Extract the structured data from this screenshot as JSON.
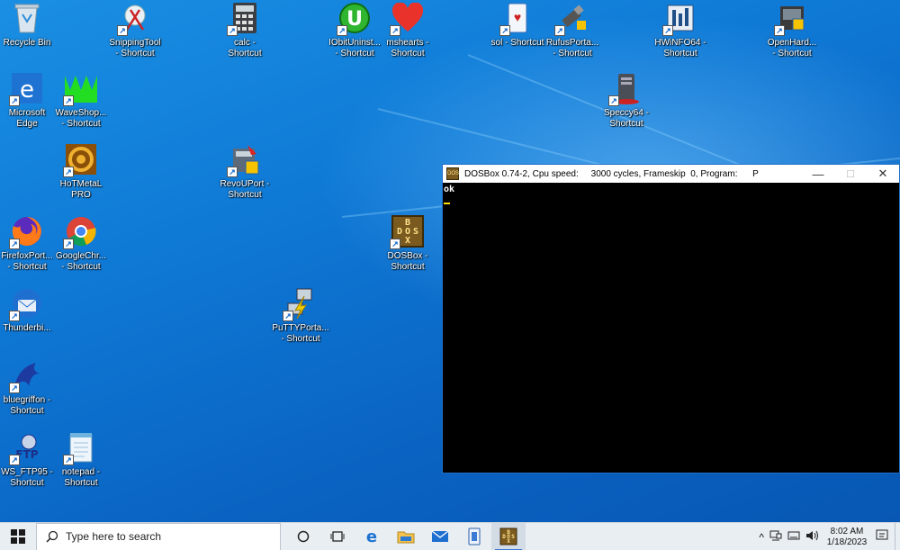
{
  "desktop": {
    "icons": [
      {
        "label": "Recycle Bin"
      },
      {
        "label": "SnippingTool\n- Shortcut"
      },
      {
        "label": "calc -\nShortcut"
      },
      {
        "label": "IObitUninst...\n- Shortcut"
      },
      {
        "label": "mshearts -\nShortcut"
      },
      {
        "label": "sol - Shortcut"
      },
      {
        "label": "RufusPorta...\n- Shortcut"
      },
      {
        "label": "HWiNFO64 -\nShortcut"
      },
      {
        "label": "OpenHard...\n- Shortcut"
      },
      {
        "label": "Microsoft\nEdge"
      },
      {
        "label": "WaveShop...\n- Shortcut"
      },
      {
        "label": "Speccy64 -\nShortcut"
      },
      {
        "label": "HoTMetaL\nPRO"
      },
      {
        "label": "RevoUPort -\nShortcut"
      },
      {
        "label": "FirefoxPort...\n- Shortcut"
      },
      {
        "label": "GoogleChr...\n- Shortcut"
      },
      {
        "label": "DOSBox -\nShortcut"
      },
      {
        "label": "Thunderbi..."
      },
      {
        "label": "PuTTYPorta...\n- Shortcut"
      },
      {
        "label": "bluegriffon -\nShortcut"
      },
      {
        "label": "WS_FTP95 -\nShortcut"
      },
      {
        "label": "notepad -\nShortcut"
      }
    ]
  },
  "dosbox": {
    "title": "DOSBox 0.74-2, Cpu speed:     3000 cycles, Frameskip  0, Program:      P",
    "screen_line": "ok",
    "minimize": "—",
    "maximize": "☐",
    "close": "✕"
  },
  "taskbar": {
    "search_placeholder": "Type here to search",
    "clock_time": "8:02 AM",
    "clock_date": "1/18/2023"
  }
}
